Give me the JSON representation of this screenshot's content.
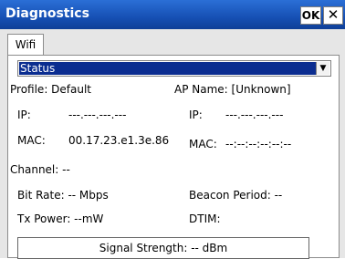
{
  "window": {
    "title": "Diagnostics",
    "ok_label": "OK",
    "close_label": "✕"
  },
  "tabs": [
    {
      "label": "Wifi"
    }
  ],
  "status_select": {
    "selected": "Status"
  },
  "info": {
    "profile": "Profile: Default",
    "ap_name": "AP Name: [Unknown]",
    "ip_label_left": "IP:",
    "ip_value_left": "---.---.---.---",
    "ip_label_right": "IP:",
    "ip_value_right": "---.---.---.---",
    "mac_label_left": "MAC:",
    "mac_value_left": "00.17.23.e1.3e.86",
    "mac_label_right": "MAC:",
    "mac_value_right": "--:--:--:--:--:--",
    "channel": "Channel: --",
    "bit_rate": "Bit Rate: -- Mbps",
    "beacon_period": "Beacon Period: --",
    "tx_power": "Tx Power: --mW",
    "dtim": "DTIM:"
  },
  "signal_strength": "Signal Strength: -- dBm"
}
